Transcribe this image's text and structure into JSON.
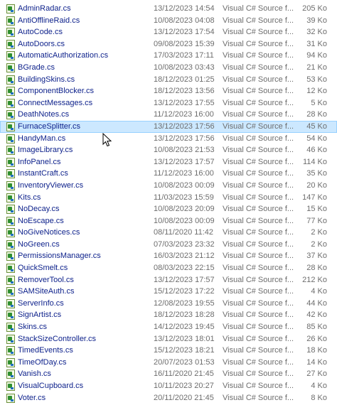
{
  "files": [
    {
      "name": "AdminRadar.cs",
      "date": "13/12/2023 14:54",
      "type": "Visual C# Source f...",
      "size": "205 Ko"
    },
    {
      "name": "AntiOfflineRaid.cs",
      "date": "10/08/2023 04:08",
      "type": "Visual C# Source f...",
      "size": "39 Ko"
    },
    {
      "name": "AutoCode.cs",
      "date": "13/12/2023 17:54",
      "type": "Visual C# Source f...",
      "size": "32 Ko"
    },
    {
      "name": "AutoDoors.cs",
      "date": "09/08/2023 15:39",
      "type": "Visual C# Source f...",
      "size": "31 Ko"
    },
    {
      "name": "AutomaticAuthorization.cs",
      "date": "17/03/2023 17:11",
      "type": "Visual C# Source f...",
      "size": "94 Ko"
    },
    {
      "name": "BGrade.cs",
      "date": "10/08/2023 03:43",
      "type": "Visual C# Source f...",
      "size": "21 Ko"
    },
    {
      "name": "BuildingSkins.cs",
      "date": "18/12/2023 01:25",
      "type": "Visual C# Source f...",
      "size": "53 Ko"
    },
    {
      "name": "ComponentBlocker.cs",
      "date": "18/12/2023 13:56",
      "type": "Visual C# Source f...",
      "size": "12 Ko"
    },
    {
      "name": "ConnectMessages.cs",
      "date": "13/12/2023 17:55",
      "type": "Visual C# Source f...",
      "size": "5 Ko"
    },
    {
      "name": "DeathNotes.cs",
      "date": "11/12/2023 16:00",
      "type": "Visual C# Source f...",
      "size": "28 Ko"
    },
    {
      "name": "FurnaceSplitter.cs",
      "date": "13/12/2023 17:56",
      "type": "Visual C# Source f...",
      "size": "45 Ko",
      "selected": true
    },
    {
      "name": "HandyMan.cs",
      "date": "13/12/2023 17:56",
      "type": "Visual C# Source f...",
      "size": "54 Ko"
    },
    {
      "name": "ImageLibrary.cs",
      "date": "10/08/2023 21:53",
      "type": "Visual C# Source f...",
      "size": "46 Ko"
    },
    {
      "name": "InfoPanel.cs",
      "date": "13/12/2023 17:57",
      "type": "Visual C# Source f...",
      "size": "114 Ko"
    },
    {
      "name": "InstantCraft.cs",
      "date": "11/12/2023 16:00",
      "type": "Visual C# Source f...",
      "size": "35 Ko"
    },
    {
      "name": "InventoryViewer.cs",
      "date": "10/08/2023 00:09",
      "type": "Visual C# Source f...",
      "size": "20 Ko"
    },
    {
      "name": "Kits.cs",
      "date": "11/03/2023 15:59",
      "type": "Visual C# Source f...",
      "size": "147 Ko"
    },
    {
      "name": "NoDecay.cs",
      "date": "10/08/2023 20:09",
      "type": "Visual C# Source f...",
      "size": "15 Ko"
    },
    {
      "name": "NoEscape.cs",
      "date": "10/08/2023 00:09",
      "type": "Visual C# Source f...",
      "size": "77 Ko"
    },
    {
      "name": "NoGiveNotices.cs",
      "date": "08/11/2020 11:42",
      "type": "Visual C# Source f...",
      "size": "2 Ko"
    },
    {
      "name": "NoGreen.cs",
      "date": "07/03/2023 23:32",
      "type": "Visual C# Source f...",
      "size": "2 Ko"
    },
    {
      "name": "PermissionsManager.cs",
      "date": "16/03/2023 21:12",
      "type": "Visual C# Source f...",
      "size": "37 Ko"
    },
    {
      "name": "QuickSmelt.cs",
      "date": "08/03/2023 22:15",
      "type": "Visual C# Source f...",
      "size": "28 Ko"
    },
    {
      "name": "RemoverTool.cs",
      "date": "13/12/2023 17:57",
      "type": "Visual C# Source f...",
      "size": "212 Ko"
    },
    {
      "name": "SAMSiteAuth.cs",
      "date": "15/12/2023 17:22",
      "type": "Visual C# Source f...",
      "size": "4 Ko"
    },
    {
      "name": "ServerInfo.cs",
      "date": "12/08/2023 19:55",
      "type": "Visual C# Source f...",
      "size": "44 Ko"
    },
    {
      "name": "SignArtist.cs",
      "date": "18/12/2023 18:28",
      "type": "Visual C# Source f...",
      "size": "42 Ko"
    },
    {
      "name": "Skins.cs",
      "date": "14/12/2023 19:45",
      "type": "Visual C# Source f...",
      "size": "85 Ko"
    },
    {
      "name": "StackSizeController.cs",
      "date": "13/12/2023 18:01",
      "type": "Visual C# Source f...",
      "size": "26 Ko"
    },
    {
      "name": "TimedEvents.cs",
      "date": "15/12/2023 18:21",
      "type": "Visual C# Source f...",
      "size": "18 Ko"
    },
    {
      "name": "TimeOfDay.cs",
      "date": "20/07/2023 01:53",
      "type": "Visual C# Source f...",
      "size": "14 Ko"
    },
    {
      "name": "Vanish.cs",
      "date": "16/11/2020 21:45",
      "type": "Visual C# Source f...",
      "size": "27 Ko"
    },
    {
      "name": "VisualCupboard.cs",
      "date": "10/11/2023 20:27",
      "type": "Visual C# Source f...",
      "size": "4 Ko"
    },
    {
      "name": "Voter.cs",
      "date": "20/11/2020 21:45",
      "type": "Visual C# Source f...",
      "size": "8 Ko"
    }
  ]
}
